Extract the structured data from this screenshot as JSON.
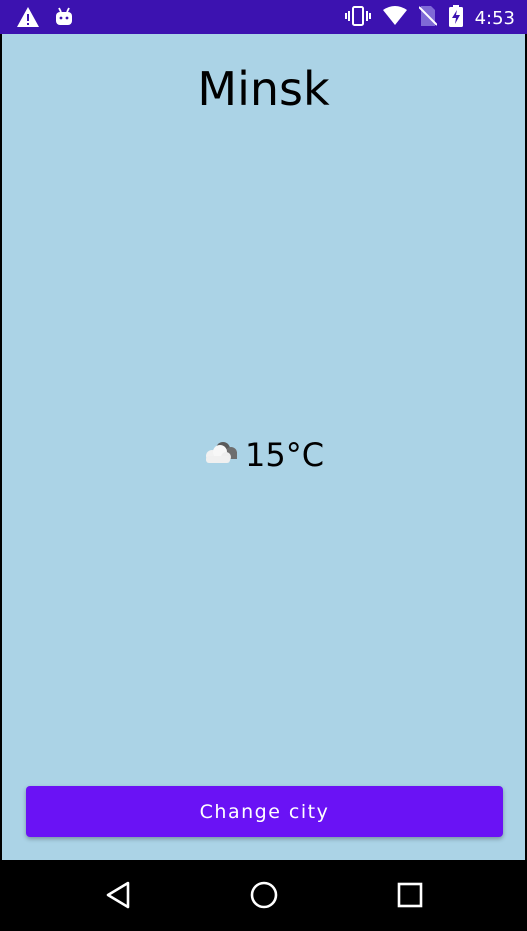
{
  "status_bar": {
    "time": "4:53",
    "left_icons": [
      "warning-icon",
      "android-debug-icon"
    ],
    "right_icons": [
      "vibrate-icon",
      "wifi-icon",
      "no-sim-icon",
      "battery-charging-icon"
    ]
  },
  "main": {
    "city": "Minsk",
    "weather_icon": "cloud-icon",
    "temperature": "15°C",
    "background_color": "#abd3e6"
  },
  "actions": {
    "change_city_label": "Change city",
    "accent_color": "#6a12f5"
  },
  "nav_bar": {
    "items": [
      "back-icon",
      "home-icon",
      "recents-icon"
    ]
  }
}
